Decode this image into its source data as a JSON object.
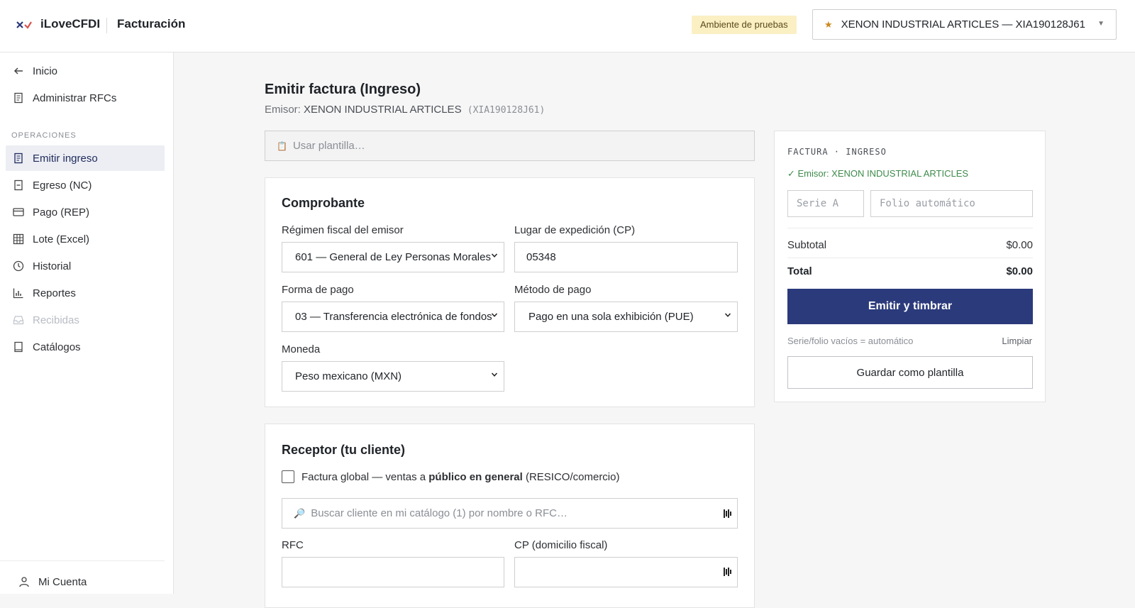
{
  "header": {
    "brand": "iLoveCFDI",
    "section": "Facturación",
    "env_badge": "Ambiente de pruebas",
    "company_selector": "XENON INDUSTRIAL ARTICLES — XIA190128J61"
  },
  "sidebar": {
    "top_items": [
      {
        "label": "Inicio",
        "icon": "arrow-left-icon"
      },
      {
        "label": "Administrar RFCs",
        "icon": "document-icon"
      }
    ],
    "operations_heading": "OPERACIONES",
    "items": [
      {
        "label": "Emitir ingreso",
        "icon": "document-icon",
        "active": true
      },
      {
        "label": "Egreso (NC)",
        "icon": "document-minus-icon"
      },
      {
        "label": "Pago (REP)",
        "icon": "credit-card-icon"
      },
      {
        "label": "Lote (Excel)",
        "icon": "grid-icon"
      },
      {
        "label": "Historial",
        "icon": "clock-icon"
      },
      {
        "label": "Reportes",
        "icon": "bar-chart-icon"
      },
      {
        "label": "Recibidas",
        "icon": "inbox-icon",
        "disabled": true
      },
      {
        "label": "Catálogos",
        "icon": "book-icon"
      }
    ],
    "account": "Mi Cuenta"
  },
  "main": {
    "title": "Emitir factura (Ingreso)",
    "emisor_prefix": "Emisor:",
    "emisor_name": "XENON INDUSTRIAL ARTICLES",
    "emisor_rfc": "(XIA190128J61)",
    "template_placeholder": "Usar plantilla…",
    "comprobante": {
      "title": "Comprobante",
      "regimen_label": "Régimen fiscal del emisor",
      "regimen_value": "601 — General de Ley Personas Morales",
      "lugar_label": "Lugar de expedición (CP)",
      "lugar_value": "05348",
      "forma_label": "Forma de pago",
      "forma_value": "03 — Transferencia electrónica de fondos",
      "metodo_label": "Método de pago",
      "metodo_value": "Pago en una sola exhibición (PUE)",
      "moneda_label": "Moneda",
      "moneda_value": "Peso mexicano (MXN)"
    },
    "receptor": {
      "title": "Receptor (tu cliente)",
      "global_pre": "Factura global — ventas a ",
      "global_bold": "público en general",
      "global_post": " (RESICO/comercio)",
      "search_placeholder": "Buscar cliente en mi catálogo (1) por nombre o RFC…",
      "rfc_label": "RFC",
      "cp_label": "CP (domicilio fiscal)"
    }
  },
  "summary": {
    "heading": "FACTURA · INGRESO",
    "emisor_ok": "✓ Emisor: XENON INDUSTRIAL ARTICLES",
    "serie_placeholder": "Serie A",
    "folio_placeholder": "Folio automático",
    "subtotal_label": "Subtotal",
    "subtotal_value": "$0.00",
    "total_label": "Total",
    "total_value": "$0.00",
    "emit_button": "Emitir y timbrar",
    "hint": "Serie/folio vacíos = automático",
    "clear": "Limpiar",
    "save_template": "Guardar como plantilla"
  },
  "colors": {
    "primary": "#2b3a7b",
    "badge_bg": "#fbefc4",
    "success": "#3e8a4b"
  }
}
